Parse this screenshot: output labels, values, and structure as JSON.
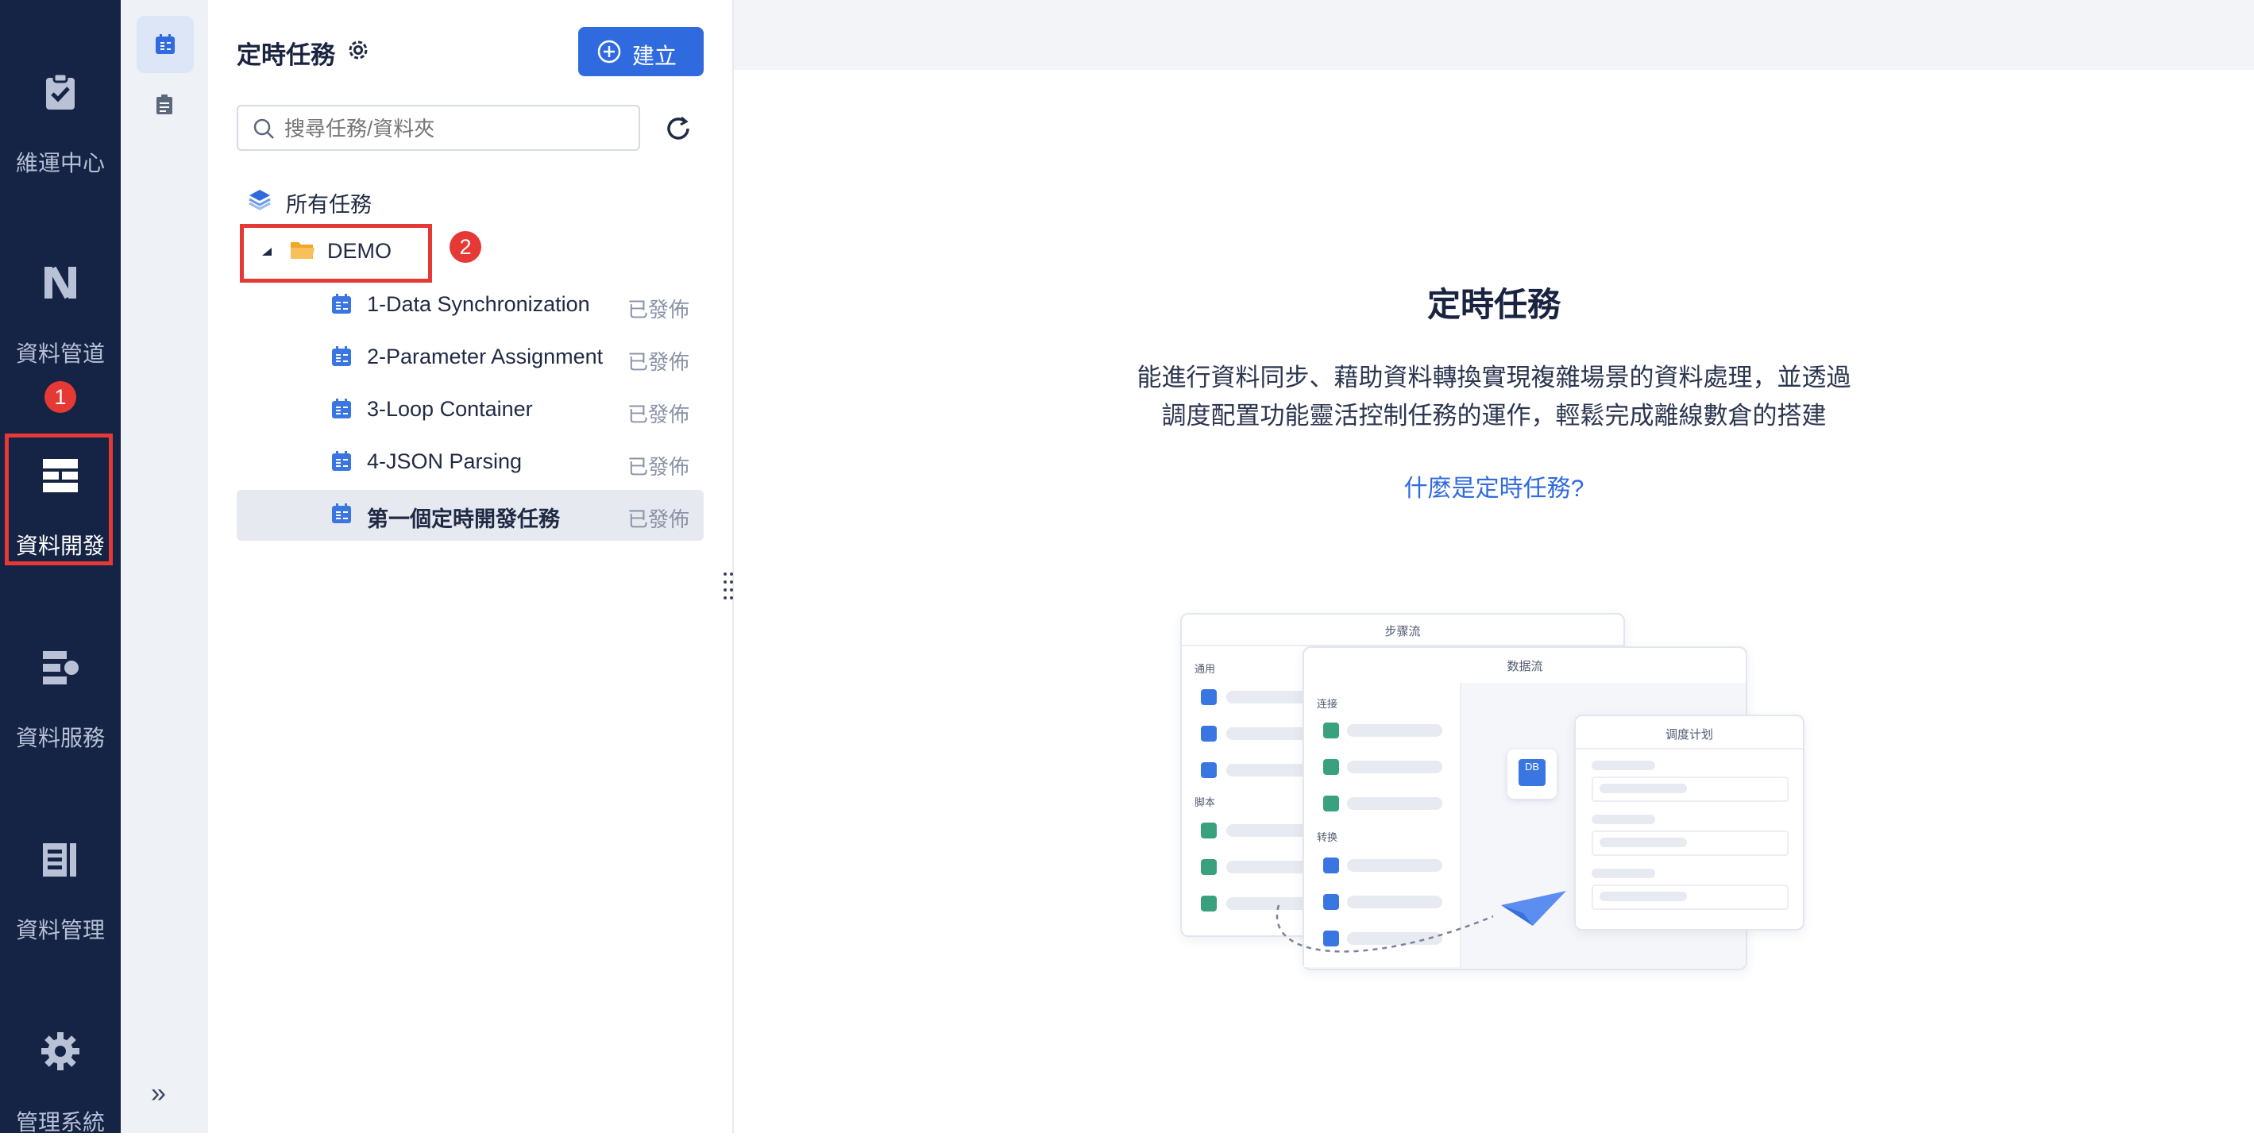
{
  "nav": {
    "items": [
      {
        "label": "維運中心",
        "icon": "clipboard-check-icon"
      },
      {
        "label": "資料管道",
        "icon": "pipeline-icon"
      },
      {
        "label": "資料開發",
        "icon": "data-dev-icon"
      },
      {
        "label": "資料服務",
        "icon": "data-service-icon"
      },
      {
        "label": "資料管理",
        "icon": "data-manage-icon"
      },
      {
        "label": "管理系統",
        "icon": "gear-icon"
      }
    ],
    "active": "資料開發",
    "callout_1": "1",
    "callout_2": "2"
  },
  "rail": {
    "icons": [
      "scheduled-task-icon",
      "task-list-icon"
    ],
    "collapse": "»"
  },
  "panel": {
    "title": "定時任務",
    "create_button": "建立",
    "search_placeholder": "搜尋任務/資料夾",
    "all_tasks": "所有任務",
    "folder": "DEMO",
    "tasks": [
      {
        "name": "1-Data Synchronization",
        "status": "已發佈"
      },
      {
        "name": "2-Parameter Assignment",
        "status": "已發佈"
      },
      {
        "name": "3-Loop Container",
        "status": "已發佈"
      },
      {
        "name": "4-JSON Parsing",
        "status": "已發佈"
      },
      {
        "name": "第一個定時開發任務",
        "status": "已發佈"
      }
    ]
  },
  "main": {
    "title": "定時任務",
    "desc_line1": "能進行資料同步、藉助資料轉換實現複雜場景的資料處理，並透過",
    "desc_line2": "調度配置功能靈活控制任務的運作，輕鬆完成離線數倉的搭建",
    "link": "什麼是定時任務?",
    "illustration": {
      "card1_title": "步骤流",
      "card1_sec1": "通用",
      "card1_sec2": "脚本",
      "card2_title": "数据流",
      "card2_sec1": "连接",
      "card2_sec2": "转换",
      "card3_title": "调度计划",
      "db_label": "DB"
    }
  },
  "colors": {
    "nav_bg": "#152344",
    "accent": "#2f6bdf",
    "highlight": "#e53935"
  }
}
